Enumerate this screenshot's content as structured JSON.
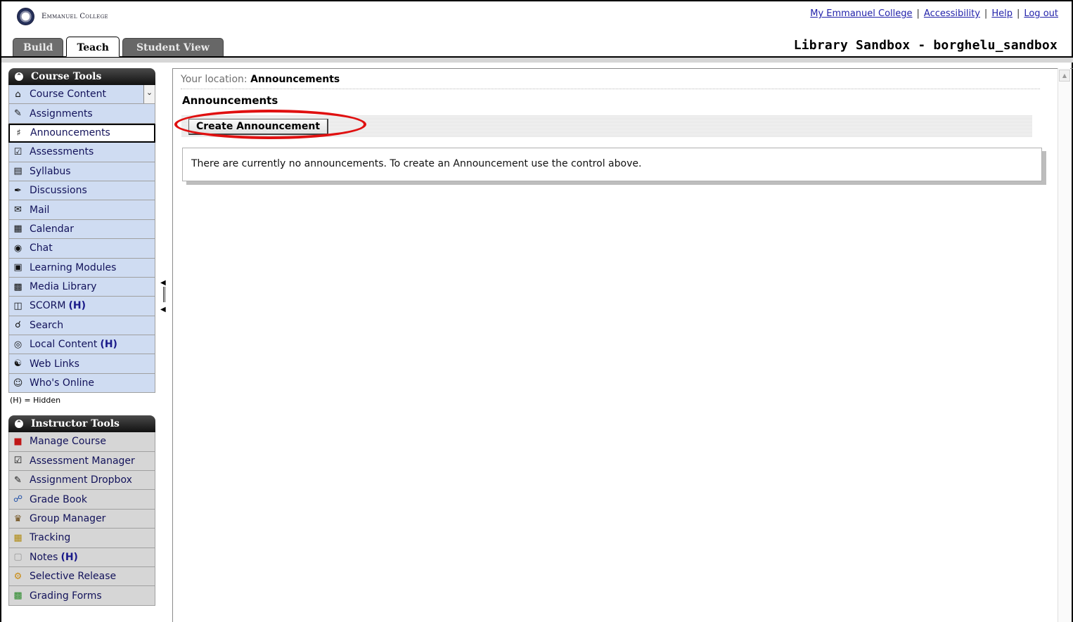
{
  "header": {
    "logo_text": "Emmanuel College",
    "links": [
      "My Emmanuel College",
      "Accessibility",
      "Help",
      "Log out"
    ],
    "course_title": "Library Sandbox - borghelu_sandbox"
  },
  "tabs": [
    {
      "label": "Build",
      "active": false
    },
    {
      "label": "Teach",
      "active": true
    },
    {
      "label": "Student View",
      "active": false
    }
  ],
  "course_tools": {
    "title": "Course Tools",
    "items": [
      {
        "label": "Course Content",
        "icon": "home-icon",
        "hidden": ""
      },
      {
        "label": "Assignments",
        "icon": "assignment-icon",
        "hidden": ""
      },
      {
        "label": "Announcements",
        "icon": "megaphone-icon",
        "hidden": ""
      },
      {
        "label": "Assessments",
        "icon": "assessment-icon",
        "hidden": ""
      },
      {
        "label": "Syllabus",
        "icon": "syllabus-icon",
        "hidden": ""
      },
      {
        "label": "Discussions",
        "icon": "pin-icon",
        "hidden": ""
      },
      {
        "label": "Mail",
        "icon": "mail-icon",
        "hidden": ""
      },
      {
        "label": "Calendar",
        "icon": "calendar-icon",
        "hidden": ""
      },
      {
        "label": "Chat",
        "icon": "chat-icon",
        "hidden": ""
      },
      {
        "label": "Learning Modules",
        "icon": "modules-icon",
        "hidden": ""
      },
      {
        "label": "Media Library",
        "icon": "media-icon",
        "hidden": ""
      },
      {
        "label": "SCORM",
        "icon": "scorm-icon",
        "hidden": "(H)"
      },
      {
        "label": "Search",
        "icon": "search-icon",
        "hidden": ""
      },
      {
        "label": "Local Content",
        "icon": "disc-icon",
        "hidden": "(H)"
      },
      {
        "label": "Web Links",
        "icon": "globe-icon",
        "hidden": ""
      },
      {
        "label": "Who's Online",
        "icon": "people-icon",
        "hidden": ""
      }
    ],
    "legend": "(H) = Hidden"
  },
  "instructor_tools": {
    "title": "Instructor Tools",
    "items": [
      {
        "label": "Manage Course",
        "icon": "cube-icon",
        "hidden": ""
      },
      {
        "label": "Assessment Manager",
        "icon": "assessment-icon",
        "hidden": ""
      },
      {
        "label": "Assignment Dropbox",
        "icon": "dropbox-icon",
        "hidden": ""
      },
      {
        "label": "Grade Book",
        "icon": "gradebook-icon",
        "hidden": ""
      },
      {
        "label": "Group Manager",
        "icon": "group-icon",
        "hidden": ""
      },
      {
        "label": "Tracking",
        "icon": "chart-icon",
        "hidden": ""
      },
      {
        "label": "Notes",
        "icon": "notes-icon",
        "hidden": "(H)"
      },
      {
        "label": "Selective Release",
        "icon": "release-icon",
        "hidden": ""
      },
      {
        "label": "Grading Forms",
        "icon": "forms-icon",
        "hidden": ""
      }
    ]
  },
  "main": {
    "location_label": "Your location:",
    "location_value": "Announcements",
    "title": "Announcements",
    "create_button": "Create Announcement",
    "empty_message": "There are currently no announcements. To create an Announcement use the control above."
  },
  "colors": {
    "course_item_bg": "#cfdcf2",
    "instructor_item_bg": "#d6d6d6",
    "highlight_ring": "#e01010",
    "link": "#2222aa"
  }
}
